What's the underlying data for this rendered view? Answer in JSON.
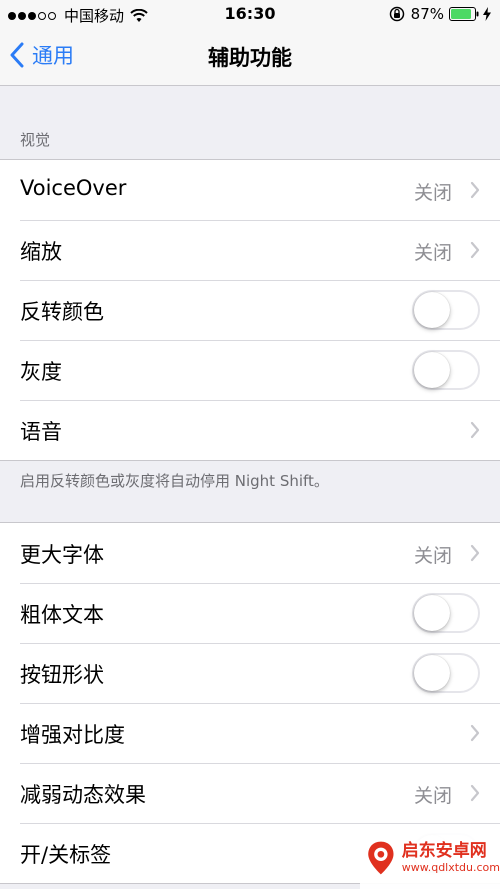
{
  "status_bar": {
    "carrier": "中国移动",
    "time": "16:30",
    "battery_percent": "87%",
    "battery_level": 0.87
  },
  "nav": {
    "back_label": "通用",
    "title": "辅助功能"
  },
  "section_vision": {
    "header": "视觉",
    "rows": [
      {
        "label": "VoiceOver",
        "value": "关闭",
        "type": "chevron"
      },
      {
        "label": "缩放",
        "value": "关闭",
        "type": "chevron"
      },
      {
        "label": "反转颜色",
        "type": "toggle",
        "on": false
      },
      {
        "label": "灰度",
        "type": "toggle",
        "on": false
      },
      {
        "label": "语音",
        "type": "chevron"
      }
    ],
    "footer": "启用反转颜色或灰度将自动停用 Night Shift。"
  },
  "section_text": {
    "rows": [
      {
        "label": "更大字体",
        "value": "关闭",
        "type": "chevron"
      },
      {
        "label": "粗体文本",
        "type": "toggle",
        "on": false
      },
      {
        "label": "按钮形状",
        "type": "toggle",
        "on": false
      },
      {
        "label": "增强对比度",
        "type": "chevron"
      },
      {
        "label": "减弱动态效果",
        "value": "关闭",
        "type": "chevron"
      },
      {
        "label": "开/关标签",
        "type": "toggle",
        "on": false
      }
    ]
  },
  "watermark": {
    "title": "启东安卓网",
    "url": "www.qdlxtdu.com"
  },
  "colors": {
    "accent": "#2b7cf6",
    "background": "#efeff4",
    "battery": "#4cd964"
  }
}
